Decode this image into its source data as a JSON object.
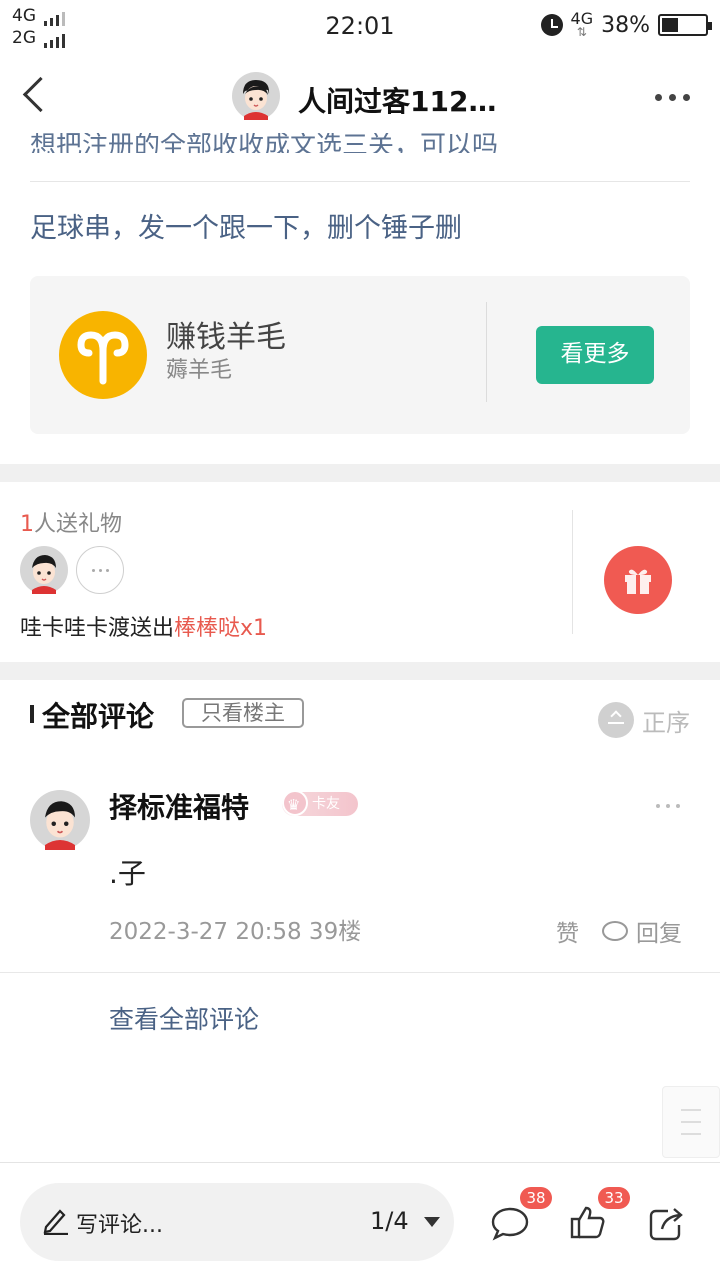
{
  "status_bar": {
    "signal_1": "4G",
    "signal_2": "2G",
    "time": "22:01",
    "network": "4G",
    "battery": "38%"
  },
  "nav": {
    "title": "人间过客112…"
  },
  "post": {
    "cut_text": "想把注册的全部收收成文选三关，可以吗",
    "line": "足球串，发一个跟一下，删个锤子删"
  },
  "forum_card": {
    "name": "赚钱羊毛",
    "subtitle": "薅羊毛",
    "button": "看更多"
  },
  "gifts": {
    "count": "1",
    "count_suffix": "人送礼物",
    "sender_text": "哇卡哇卡渡送出",
    "gift_name": "棒棒哒x1"
  },
  "comments": {
    "title": "全部评论",
    "only_owner": "只看楼主",
    "sort": "正序",
    "items": [
      {
        "name": "择标准福特",
        "badge": "卡友",
        "text": ".子",
        "meta": "2022-3-27 20:58  39楼",
        "like": "赞",
        "reply": "回复"
      }
    ],
    "view_all": "查看全部评论"
  },
  "bottom": {
    "placeholder": "写评论...",
    "page": "1/4",
    "comment_count": "38",
    "like_count": "33"
  },
  "colors": {
    "link_blue": "#4a6285",
    "accent_green": "#26b58f",
    "accent_red": "#f05a52",
    "forum_icon": "#f8b400"
  },
  "icons": [
    "back-icon",
    "more-icon",
    "aries-icon",
    "gift-icon",
    "sort-icon",
    "crown-icon",
    "pen-icon",
    "comment-icon",
    "thumbs-up-icon",
    "share-icon"
  ]
}
